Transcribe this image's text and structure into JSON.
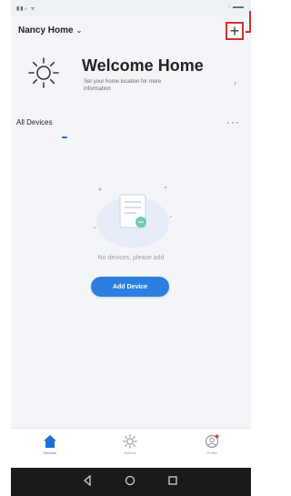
{
  "header": {
    "home_name": "Nancy Home",
    "chevron": "⌄",
    "add_icon": "+"
  },
  "welcome": {
    "title": "Welcome Home",
    "subtitle": "Set your home location for more information",
    "chevron": "›"
  },
  "tabs": {
    "all_devices": "All Devices",
    "more": "···"
  },
  "empty_state": {
    "message": "No devices, please add",
    "add_button": "Add Device"
  },
  "bottom_nav": {
    "items": [
      {
        "label": "Devices",
        "icon": "home-icon"
      },
      {
        "label": "Actions",
        "icon": "sun-icon"
      },
      {
        "label": "Profile",
        "icon": "profile-icon"
      }
    ]
  },
  "colors": {
    "accent": "#2a7fe0",
    "highlight": "#d32f2f"
  }
}
